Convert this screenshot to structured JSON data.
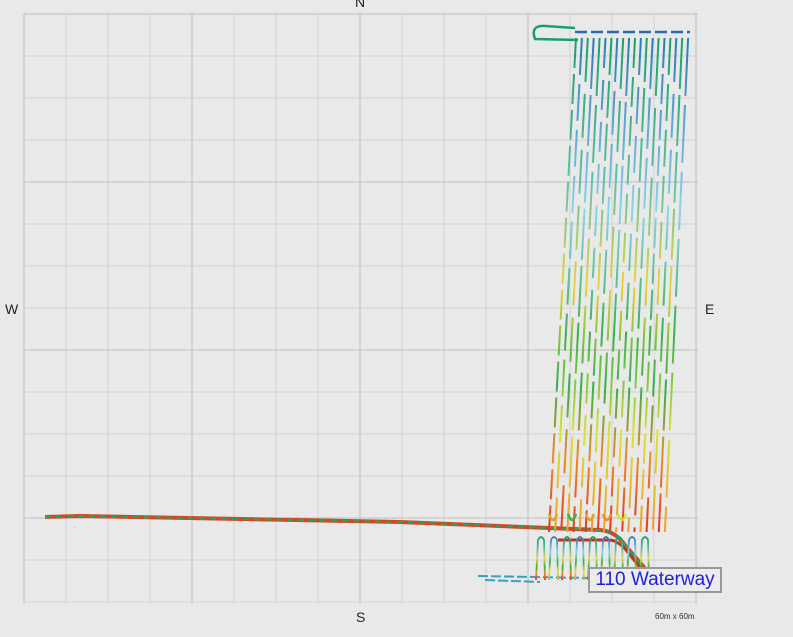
{
  "compass": {
    "north": "N",
    "south": "S",
    "west": "W",
    "east": "E"
  },
  "track_label": "110 Waterway",
  "scale_text": "60m x 60m",
  "colors": {
    "background": "#e9e9e9",
    "grid": "#d2d2d2",
    "grid_major": "#bdbdbd",
    "label_text": "#2020e0"
  }
}
